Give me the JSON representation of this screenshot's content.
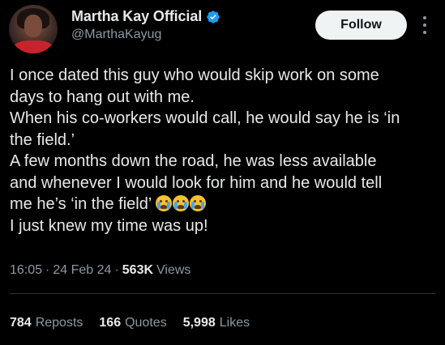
{
  "author": {
    "display_name": "Martha Kay Official",
    "handle": "@MarthaKayug",
    "verified": true
  },
  "actions": {
    "follow_label": "Follow"
  },
  "tweet": {
    "lines": [
      "I once dated this guy who would skip work on some",
      "days to hang out with me.",
      "When his co-workers would call, he would say he is ‘in",
      "the field.’",
      "A few months down the road, he was less available",
      "and whenever I would look for him and he would tell",
      "me he’s ‘in the field’",
      "I just knew my time was up!"
    ],
    "emoji": [
      "loudly-crying-face",
      "loudly-crying-face",
      "loudly-crying-face"
    ]
  },
  "meta": {
    "time": "16:05",
    "date": "24 Feb 24",
    "separator": "·",
    "views_count": "563K",
    "views_label": "Views"
  },
  "stats": {
    "reposts_count": "784",
    "reposts_label": "Reposts",
    "quotes_count": "166",
    "quotes_label": "Quotes",
    "likes_count": "5,998",
    "likes_label": "Likes"
  },
  "colors": {
    "background": "#000000",
    "text": "#e7e9ea",
    "secondary_text": "#8b98a5",
    "verified_badge": "#1d9bf0",
    "follow_button_bg": "#eff3f4"
  }
}
